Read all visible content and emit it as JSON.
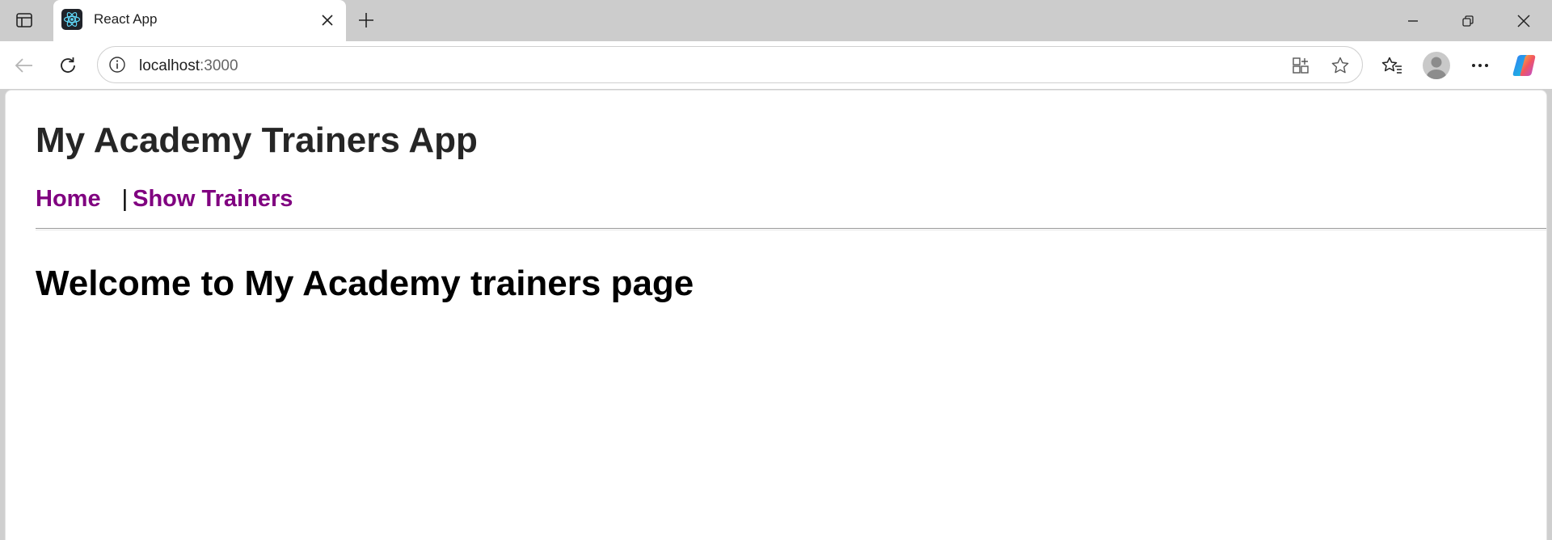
{
  "browser": {
    "tab": {
      "title": "React App",
      "favicon": "react-logo-icon"
    },
    "address": {
      "host": "localhost",
      "port": ":3000"
    },
    "icons": {
      "tab_actions": "tab-actions-icon",
      "close_tab": "close-icon",
      "new_tab": "plus-icon",
      "minimize": "minimize-icon",
      "restore": "restore-icon",
      "close_window": "close-icon",
      "back": "back-arrow-icon",
      "refresh": "refresh-icon",
      "site_info": "info-icon",
      "app_available": "app-install-icon",
      "favorite": "star-icon",
      "favorites": "favorites-icon",
      "profile": "avatar-icon",
      "more": "more-icon",
      "copilot": "copilot-icon"
    }
  },
  "page": {
    "app_title": "My Academy Trainers App",
    "nav": {
      "home": "Home",
      "separator": "|",
      "show_trainers": "Show Trainers",
      "link_color": "#800080"
    },
    "heading": "Welcome to My Academy trainers page"
  }
}
